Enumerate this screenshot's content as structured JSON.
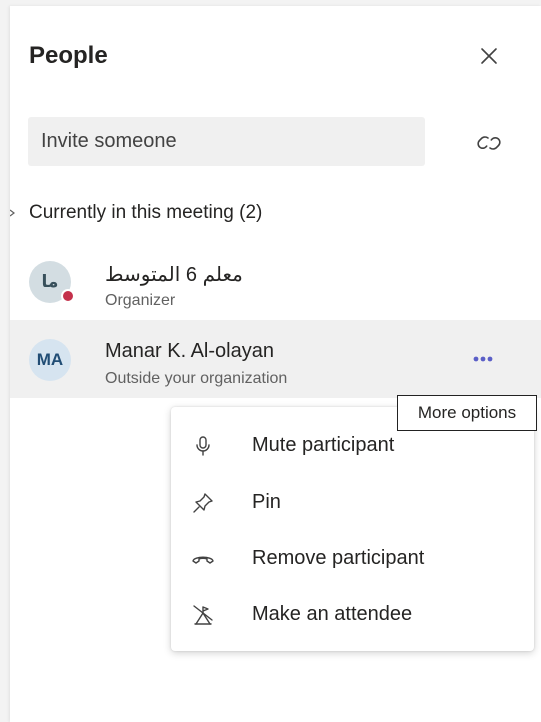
{
  "panel": {
    "title": "People",
    "invite_placeholder": "Invite someone",
    "section_label": "Currently in this meeting (2)"
  },
  "participants": [
    {
      "initials": "ما",
      "name": "معلم 6 المتوسط",
      "role": "Organizer",
      "status_color": "#c4314b"
    },
    {
      "initials": "MA",
      "name": "Manar K. Al-olayan",
      "role": "Outside your organization"
    }
  ],
  "tooltip": "More options",
  "context_menu": {
    "items": [
      {
        "label": "Mute participant",
        "icon": "microphone-icon"
      },
      {
        "label": "Pin",
        "icon": "pin-icon"
      },
      {
        "label": "Remove participant",
        "icon": "remove-participant-icon"
      },
      {
        "label": "Make an attendee",
        "icon": "make-attendee-icon"
      }
    ]
  },
  "colors": {
    "accent": "#6264a7",
    "hover_row": "#f0f0f0",
    "status_busy": "#c4314b"
  }
}
